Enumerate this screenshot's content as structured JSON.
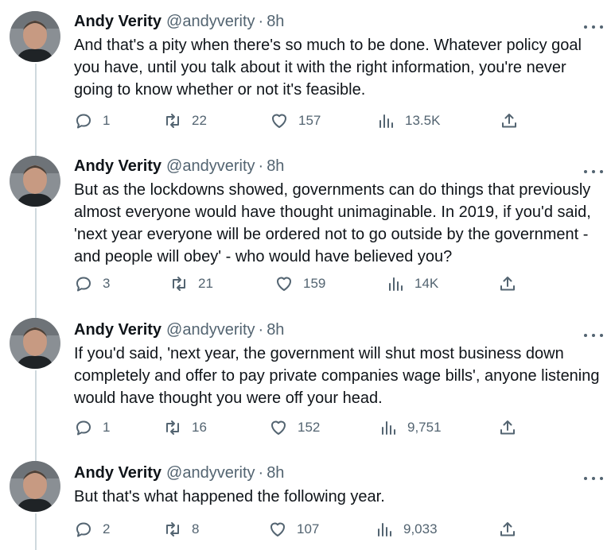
{
  "tweets": [
    {
      "name": "Andy Verity",
      "handle": "@andyverity",
      "separator": "·",
      "time": "8h",
      "text": "And that's a pity when there's so much to be done. Whatever policy goal you have, until you talk about it with the right information, you're never going to know whether or not it's feasible.",
      "replies": "1",
      "retweets": "22",
      "likes": "157",
      "views": "13.5K"
    },
    {
      "name": "Andy Verity",
      "handle": "@andyverity",
      "separator": "·",
      "time": "8h",
      "text": "But as the lockdowns showed, governments can do things that previously almost everyone would have thought unimaginable. In 2019, if you'd said, 'next year everyone will be ordered not to go outside by the government - and people will obey' - who would have believed you?",
      "replies": "3",
      "retweets": "21",
      "likes": "159",
      "views": "14K"
    },
    {
      "name": "Andy Verity",
      "handle": "@andyverity",
      "separator": "·",
      "time": "8h",
      "text": "If you'd said, 'next year, the government will shut most business down completely and offer to pay private companies wage bills', anyone listening would have thought you were off your head.",
      "replies": "1",
      "retweets": "16",
      "likes": "152",
      "views": "9,751"
    },
    {
      "name": "Andy Verity",
      "handle": "@andyverity",
      "separator": "·",
      "time": "8h",
      "text": "But that's what happened the following year.",
      "replies": "2",
      "retweets": "8",
      "likes": "107",
      "views": "9,033"
    }
  ],
  "icons": {
    "reply": "reply-icon",
    "retweet": "retweet-icon",
    "like": "heart-icon",
    "views": "views-icon",
    "share": "share-icon",
    "more": "more-icon"
  },
  "colors": {
    "text": "#0f1419",
    "secondary": "#536471",
    "thread_line": "#cfd9de"
  }
}
